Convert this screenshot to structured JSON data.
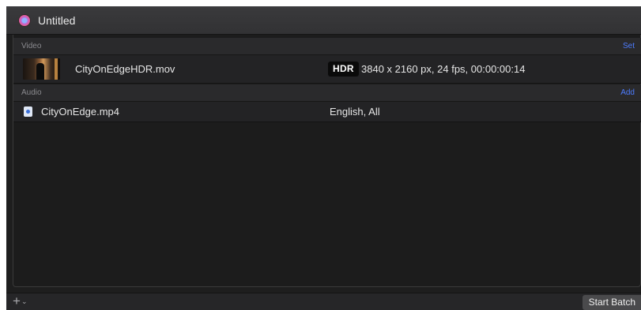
{
  "window": {
    "title": "Untitled",
    "icon": "compressor-project-icon"
  },
  "video": {
    "section_label": "Video",
    "action_label": "Set",
    "file": {
      "name": "CityOnEdgeHDR.mov",
      "badge": "HDR",
      "info": "3840 x 2160 px, 24 fps, 00:00:00:14",
      "thumbnail_icon": "video-thumbnail"
    }
  },
  "audio": {
    "section_label": "Audio",
    "action_label": "Add",
    "file": {
      "name": "CityOnEdge.mp4",
      "info": "English, All",
      "icon": "audio-file-icon"
    }
  },
  "footer": {
    "add_icon": "+",
    "chevron_icon": "⌄",
    "start_batch_label": "Start Batch"
  },
  "colors": {
    "accent": "#4d7cff",
    "background": "#1c1c1c"
  }
}
